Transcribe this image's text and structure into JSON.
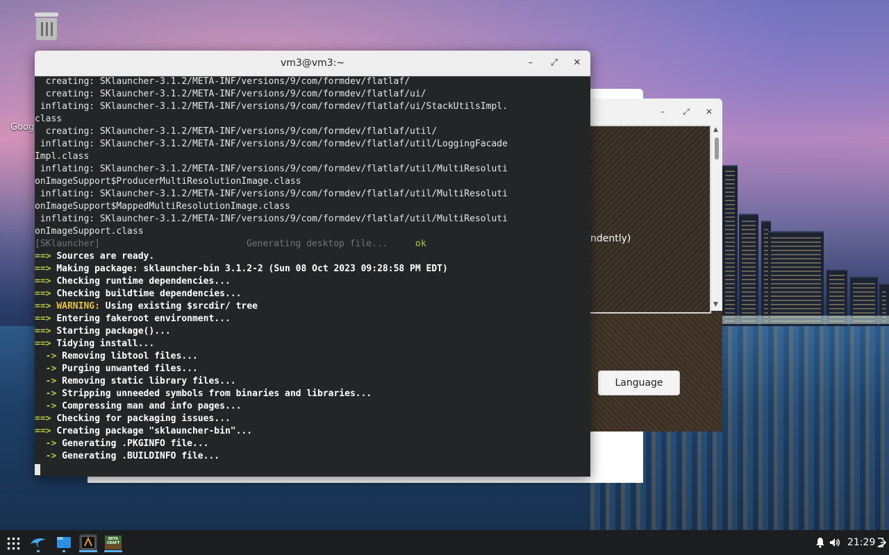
{
  "desktop": {
    "trash_icon": "trash-icon",
    "google_label": "Goog"
  },
  "launcher_window": {
    "minimize": "–",
    "maximize": "⤢",
    "close": "✕",
    "partial_text": "ndently)",
    "language_button": "Language"
  },
  "terminal": {
    "title": "vm3@vm3:~",
    "minimize": "–",
    "maximize": "⤢",
    "close": "✕",
    "lines": [
      "  creating: SKlauncher-3.1.2/META-INF/versions/9/com/formdev/flatlaf/",
      "  creating: SKlauncher-3.1.2/META-INF/versions/9/com/formdev/flatlaf/ui/",
      " inflating: SKlauncher-3.1.2/META-INF/versions/9/com/formdev/flatlaf/ui/StackUtilsImpl.",
      "class",
      "  creating: SKlauncher-3.1.2/META-INF/versions/9/com/formdev/flatlaf/util/",
      " inflating: SKlauncher-3.1.2/META-INF/versions/9/com/formdev/flatlaf/util/LoggingFacade",
      "Impl.class",
      " inflating: SKlauncher-3.1.2/META-INF/versions/9/com/formdev/flatlaf/util/MultiResoluti",
      "onImageSupport$ProducerMultiResolutionImage.class",
      " inflating: SKlauncher-3.1.2/META-INF/versions/9/com/formdev/flatlaf/util/MultiResoluti",
      "onImageSupport$MappedMultiResolutionImage.class",
      " inflating: SKlauncher-3.1.2/META-INF/versions/9/com/formdev/flatlaf/util/MultiResoluti",
      "onImageSupport.class"
    ],
    "sk_tag": "[SKlauncher]",
    "sk_msg": "Generating desktop file...",
    "sk_ok": "ok",
    "arrow_main": "==>",
    "arrow_sub": "->",
    "warning_label": "WARNING:",
    "build_main": [
      "Sources are ready.",
      "Making package: sklauncher-bin 3.1.2-2 (Sun 08 Oct 2023 09:28:58 PM EDT)",
      "Checking runtime dependencies...",
      "Checking buildtime dependencies...",
      "Using existing $srcdir/ tree",
      "Entering fakeroot environment...",
      "Starting package()...",
      "Tidying install..."
    ],
    "tidy_sub": [
      "Removing libtool files...",
      "Purging unwanted files...",
      "Removing static library files...",
      "Stripping unneeded symbols from binaries and libraries...",
      "Compressing man and info pages..."
    ],
    "final_main": [
      "Checking for packaging issues...",
      "Creating package \"sklauncher-bin\"..."
    ],
    "final_sub": [
      "Generating .PKGINFO file...",
      "Generating .BUILDINFO file..."
    ]
  },
  "taskbar": {
    "clock": "21:29",
    "apps": [
      "app-launcher-icon",
      "dolphin-icon",
      "file-manager-icon",
      "terminal-icon",
      "betacraft-icon"
    ],
    "betacraft_label": "BETA CRAFT"
  }
}
